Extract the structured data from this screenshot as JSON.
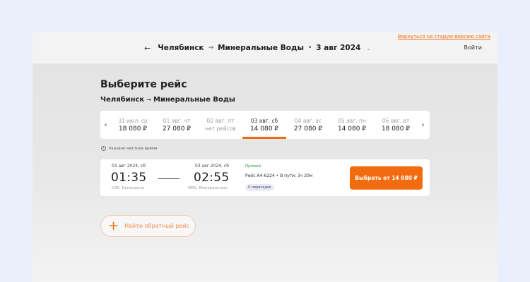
{
  "header": {
    "back_icon": "arrow-left-icon",
    "from": "Челябинск",
    "to": "Минеральные Воды",
    "arrow": "→",
    "dot": "•",
    "date": "3 авг 2024",
    "date_chevron_icon": "chevron-down-icon",
    "old_version_link": "Вернуться на старую версию сайта",
    "login": "Войти"
  },
  "page": {
    "title": "Выберите рейс",
    "route_from": "Челябинск",
    "route_arrow": "→",
    "route_to": "Минеральные Воды"
  },
  "date_strip": {
    "prev_icon": "chevron-left-icon",
    "next_icon": "chevron-right-icon",
    "items": [
      {
        "label": "31 июл. ср",
        "price": "18 080 ₽"
      },
      {
        "label": "01 авг. чт",
        "price": "27 080 ₽"
      },
      {
        "label": "02 авг. пт",
        "price": "нет рейсов"
      },
      {
        "label": "03 авг. сб",
        "price": "14 080 ₽",
        "selected": true
      },
      {
        "label": "04 авг. вс",
        "price": "27 080 ₽"
      },
      {
        "label": "05 авг. пн",
        "price": "14 080 ₽"
      },
      {
        "label": "06 авг. вт",
        "price": "18 080 ₽"
      }
    ]
  },
  "note": {
    "icon": "info-icon",
    "text": "Указано местное время"
  },
  "flight": {
    "dep_date": "03 авг 2024, сб",
    "dep_time": "01:35",
    "dep_airport": "CEK, Баландино",
    "arr_date": "03 авг 2024, сб",
    "arr_time": "02:55",
    "arr_airport": "MRV, Минеральные",
    "direct": "Прямой",
    "info": "Рейс А4-6224 • В пути: 3ч 20м",
    "transfers": "0 пересадок",
    "select_button": "Выбрать от 14 080 ₽"
  },
  "return": {
    "plus_icon": "plus-icon",
    "label": "Найти обратный рейс"
  },
  "colors": {
    "accent": "#f26b0f",
    "direct": "#2e9b3a",
    "background": "#e9f0fb"
  }
}
